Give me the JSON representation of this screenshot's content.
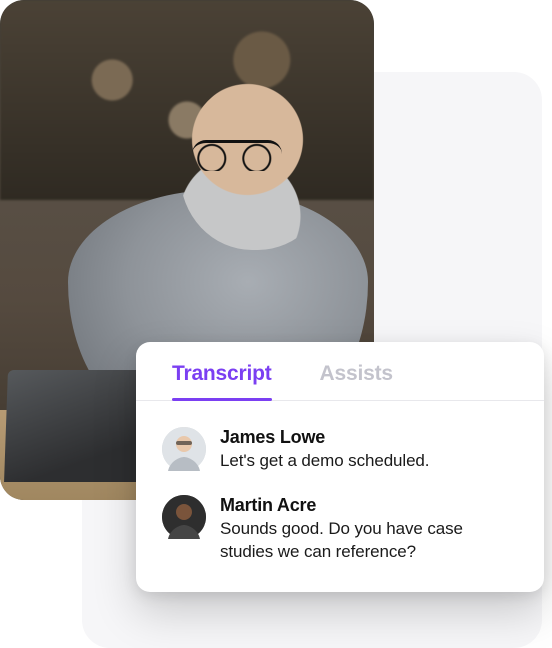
{
  "tabs": [
    {
      "label": "Transcript",
      "active": true
    },
    {
      "label": "Assists",
      "active": false
    }
  ],
  "messages": [
    {
      "name": "James Lowe",
      "text": "Let's get a demo scheduled."
    },
    {
      "name": "Martin Acre",
      "text": "Sounds good. Do you have case studies we can reference?"
    }
  ],
  "colors": {
    "accent": "#7b3ff2"
  }
}
